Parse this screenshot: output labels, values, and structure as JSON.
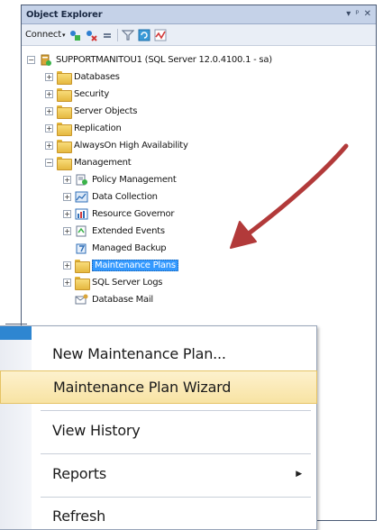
{
  "object_explorer": {
    "title": "Object Explorer",
    "title_controls": [
      "▾",
      "ᵖ",
      "✕"
    ],
    "toolbar": {
      "connect_label": "Connect",
      "connect_caret": "▾"
    },
    "server": "SUPPORTMANITOU1 (SQL Server 12.0.4100.1 - sa)",
    "top_nodes": [
      "Databases",
      "Security",
      "Server Objects",
      "Replication",
      "AlwaysOn High Availability",
      "Management"
    ],
    "management_children": [
      "Policy Management",
      "Data Collection",
      "Resource Governor",
      "Extended Events",
      "Managed Backup",
      "Maintenance Plans",
      "SQL Server Logs",
      "Database Mail"
    ],
    "selected_node": "Maintenance Plans",
    "expander_collapsed": "+",
    "expander_expanded": "−"
  },
  "context_menu": {
    "items": [
      {
        "label": "New Maintenance Plan..."
      },
      {
        "label": "Maintenance Plan Wizard"
      },
      {
        "label": "View History"
      },
      {
        "label": "Reports"
      },
      {
        "label": "Refresh"
      }
    ],
    "highlighted_item": "Maintenance Plan Wizard",
    "submenu_glyph": "▶"
  },
  "colors": {
    "selection": "#3399ff",
    "menu_highlight": "#f8e3a3",
    "arrow": "#b23a3a",
    "folder": "#e5b840"
  }
}
